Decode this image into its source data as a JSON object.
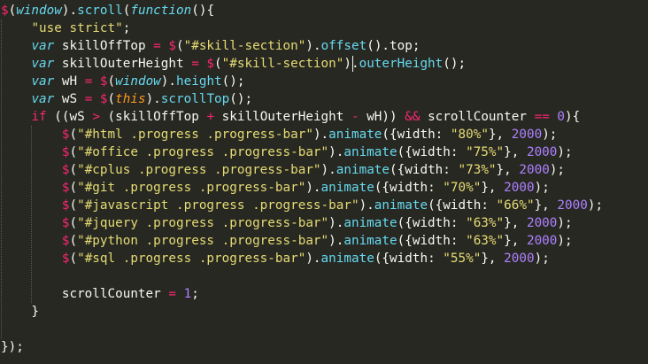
{
  "editor": {
    "theme_colors": {
      "background": "#272822",
      "plain": "#f8f8f2",
      "keyword": "#f92672",
      "storage": "#66d9ef",
      "string": "#e6db74",
      "number": "#ae81ff",
      "this": "#fd971f"
    },
    "lines": [
      [
        [
          "kw",
          "$"
        ],
        [
          "p",
          "("
        ],
        [
          "var",
          "window"
        ],
        [
          "p",
          ")."
        ],
        [
          "fn",
          "scroll"
        ],
        [
          "p",
          "("
        ],
        [
          "var",
          "function"
        ],
        [
          "p",
          "(){"
        ]
      ],
      [
        [
          "p",
          "    "
        ],
        [
          "str",
          "\"use strict\""
        ],
        [
          "p",
          ";"
        ]
      ],
      [
        [
          "p",
          "    "
        ],
        [
          "var",
          "var"
        ],
        [
          "p",
          " skillOffTop "
        ],
        [
          "kw",
          "="
        ],
        [
          "p",
          " "
        ],
        [
          "kw",
          "$"
        ],
        [
          "p",
          "("
        ],
        [
          "str",
          "\"#skill-section\""
        ],
        [
          "p",
          ")."
        ],
        [
          "fn",
          "offset"
        ],
        [
          "p",
          "().top;"
        ]
      ],
      [
        [
          "p",
          "    "
        ],
        [
          "var",
          "var"
        ],
        [
          "p",
          " skillOuterHeight "
        ],
        [
          "kw",
          "="
        ],
        [
          "p",
          " "
        ],
        [
          "kw",
          "$"
        ],
        [
          "p",
          "("
        ],
        [
          "str",
          "\"#skill-section\""
        ],
        [
          "p",
          ")."
        ],
        [
          "fn",
          "outerHeight"
        ],
        [
          "p",
          "();"
        ]
      ],
      [
        [
          "p",
          "    "
        ],
        [
          "var",
          "var"
        ],
        [
          "p",
          " wH "
        ],
        [
          "kw",
          "="
        ],
        [
          "p",
          " "
        ],
        [
          "kw",
          "$"
        ],
        [
          "p",
          "("
        ],
        [
          "var",
          "window"
        ],
        [
          "p",
          ")."
        ],
        [
          "fn",
          "height"
        ],
        [
          "p",
          "();"
        ]
      ],
      [
        [
          "p",
          "    "
        ],
        [
          "var",
          "var"
        ],
        [
          "p",
          " wS "
        ],
        [
          "kw",
          "="
        ],
        [
          "p",
          " "
        ],
        [
          "kw",
          "$"
        ],
        [
          "p",
          "("
        ],
        [
          "this",
          "this"
        ],
        [
          "p",
          ")."
        ],
        [
          "fn",
          "scrollTop"
        ],
        [
          "p",
          "();"
        ]
      ],
      [
        [
          "p",
          "    "
        ],
        [
          "kw",
          "if"
        ],
        [
          "p",
          " ((wS "
        ],
        [
          "kw",
          ">"
        ],
        [
          "p",
          " (skillOffTop "
        ],
        [
          "kw",
          "+"
        ],
        [
          "p",
          " skillOuterHeight "
        ],
        [
          "kw",
          "-"
        ],
        [
          "p",
          " wH)) "
        ],
        [
          "kw",
          "&&"
        ],
        [
          "p",
          " scrollCounter "
        ],
        [
          "kw",
          "=="
        ],
        [
          "p",
          " "
        ],
        [
          "num",
          "0"
        ],
        [
          "p",
          "){"
        ]
      ],
      [
        [
          "p",
          "        "
        ],
        [
          "kw",
          "$"
        ],
        [
          "p",
          "("
        ],
        [
          "str",
          "\"#html .progress .progress-bar\""
        ],
        [
          "p",
          ")."
        ],
        [
          "fn",
          "animate"
        ],
        [
          "p",
          "({width: "
        ],
        [
          "str",
          "\"80%\""
        ],
        [
          "p",
          "}, "
        ],
        [
          "num",
          "2000"
        ],
        [
          "p",
          ");"
        ]
      ],
      [
        [
          "p",
          "        "
        ],
        [
          "kw",
          "$"
        ],
        [
          "p",
          "("
        ],
        [
          "str",
          "\"#office .progress .progress-bar\""
        ],
        [
          "p",
          ")."
        ],
        [
          "fn",
          "animate"
        ],
        [
          "p",
          "({width: "
        ],
        [
          "str",
          "\"75%\""
        ],
        [
          "p",
          "}, "
        ],
        [
          "num",
          "2000"
        ],
        [
          "p",
          ");"
        ]
      ],
      [
        [
          "p",
          "        "
        ],
        [
          "kw",
          "$"
        ],
        [
          "p",
          "("
        ],
        [
          "str",
          "\"#cplus .progress .progress-bar\""
        ],
        [
          "p",
          ")."
        ],
        [
          "fn",
          "animate"
        ],
        [
          "p",
          "({width: "
        ],
        [
          "str",
          "\"73%\""
        ],
        [
          "p",
          "}, "
        ],
        [
          "num",
          "2000"
        ],
        [
          "p",
          ");"
        ]
      ],
      [
        [
          "p",
          "        "
        ],
        [
          "kw",
          "$"
        ],
        [
          "p",
          "("
        ],
        [
          "str",
          "\"#git .progress .progress-bar\""
        ],
        [
          "p",
          ")."
        ],
        [
          "fn",
          "animate"
        ],
        [
          "p",
          "({width: "
        ],
        [
          "str",
          "\"70%\""
        ],
        [
          "p",
          "}, "
        ],
        [
          "num",
          "2000"
        ],
        [
          "p",
          ");"
        ]
      ],
      [
        [
          "p",
          "        "
        ],
        [
          "kw",
          "$"
        ],
        [
          "p",
          "("
        ],
        [
          "str",
          "\"#javascript .progress .progress-bar\""
        ],
        [
          "p",
          ")."
        ],
        [
          "fn",
          "animate"
        ],
        [
          "p",
          "({width: "
        ],
        [
          "str",
          "\"66%\""
        ],
        [
          "p",
          "}, "
        ],
        [
          "num",
          "2000"
        ],
        [
          "p",
          ");"
        ]
      ],
      [
        [
          "p",
          "        "
        ],
        [
          "kw",
          "$"
        ],
        [
          "p",
          "("
        ],
        [
          "str",
          "\"#jquery .progress .progress-bar\""
        ],
        [
          "p",
          ")."
        ],
        [
          "fn",
          "animate"
        ],
        [
          "p",
          "({width: "
        ],
        [
          "str",
          "\"63%\""
        ],
        [
          "p",
          "}, "
        ],
        [
          "num",
          "2000"
        ],
        [
          "p",
          ");"
        ]
      ],
      [
        [
          "p",
          "        "
        ],
        [
          "kw",
          "$"
        ],
        [
          "p",
          "("
        ],
        [
          "str",
          "\"#python .progress .progress-bar\""
        ],
        [
          "p",
          ")."
        ],
        [
          "fn",
          "animate"
        ],
        [
          "p",
          "({width: "
        ],
        [
          "str",
          "\"63%\""
        ],
        [
          "p",
          "}, "
        ],
        [
          "num",
          "2000"
        ],
        [
          "p",
          ");"
        ]
      ],
      [
        [
          "p",
          "        "
        ],
        [
          "kw",
          "$"
        ],
        [
          "p",
          "("
        ],
        [
          "str",
          "\"#sql .progress .progress-bar\""
        ],
        [
          "p",
          ")."
        ],
        [
          "fn",
          "animate"
        ],
        [
          "p",
          "({width: "
        ],
        [
          "str",
          "\"55%\""
        ],
        [
          "p",
          "}, "
        ],
        [
          "num",
          "2000"
        ],
        [
          "p",
          ");"
        ]
      ],
      [],
      [
        [
          "p",
          "        scrollCounter "
        ],
        [
          "kw",
          "="
        ],
        [
          "p",
          " "
        ],
        [
          "num",
          "1"
        ],
        [
          "p",
          ";"
        ]
      ],
      [
        [
          "p",
          "    }"
        ]
      ],
      [],
      [
        [
          "p",
          "});"
        ]
      ]
    ]
  }
}
